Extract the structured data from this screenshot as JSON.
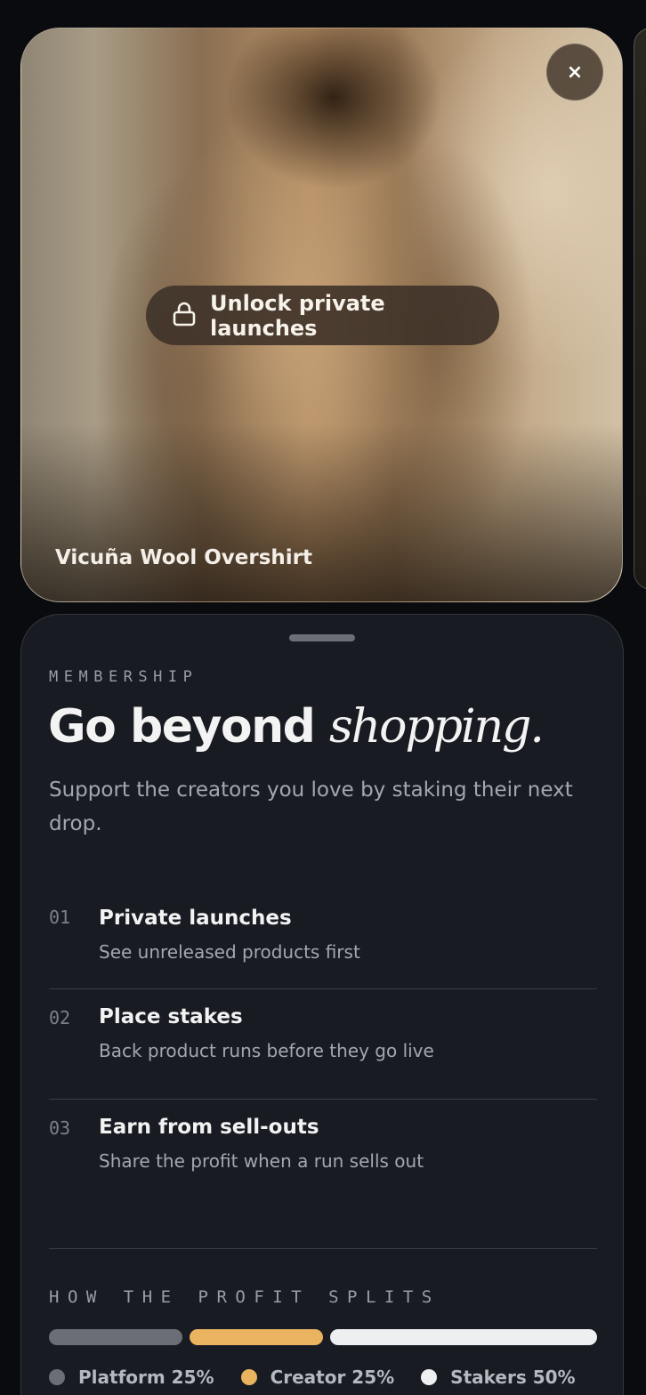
{
  "product": {
    "unlock_label": "Unlock private launches",
    "name": "Vicuña Wool Overshirt",
    "close_glyph": "×",
    "lock_icon": "lock-icon"
  },
  "membership": {
    "eyebrow": "MEMBERSHIP",
    "headline_plain": "Go beyond ",
    "headline_accent": "shopping.",
    "subcopy": "Support the creators you love by staking their next drop.",
    "benefits": [
      {
        "num": "01",
        "title": "Private launches",
        "desc": "See unreleased products first"
      },
      {
        "num": "02",
        "title": "Place stakes",
        "desc": "Back product runs before they go live"
      },
      {
        "num": "03",
        "title": "Earn from sell-outs",
        "desc": "Share the profit when a run sells out"
      }
    ],
    "split_label": "HOW THE PROFIT SPLITS",
    "split": [
      {
        "label": "Platform 25%",
        "share": 25,
        "color": "#6b6e74"
      },
      {
        "label": "Creator 25%",
        "share": 25,
        "color": "#e9b360"
      },
      {
        "label": "Stakers 50%",
        "share": 50,
        "color": "#eeeff1"
      }
    ]
  }
}
